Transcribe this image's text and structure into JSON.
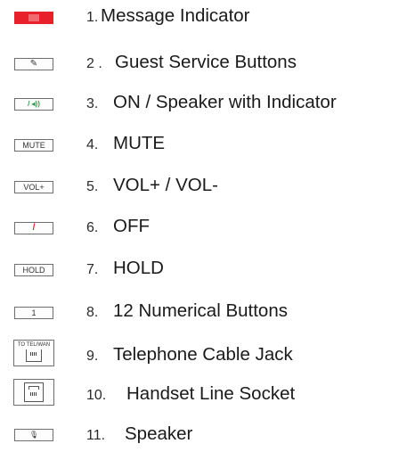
{
  "legend": [
    {
      "number": "1.",
      "label": "Message Indicator",
      "icon": "red-indicator-icon",
      "icon_text": ""
    },
    {
      "number": "2 .",
      "label": "Guest Service Buttons",
      "icon": "guest-service-icon",
      "icon_text": "✎"
    },
    {
      "number": "3.",
      "label": "ON / Speaker with Indicator",
      "icon": "handset-speaker-icon",
      "icon_text": "/ ◂))"
    },
    {
      "number": "4.",
      "label": "MUTE",
      "icon": "mute-key-icon",
      "icon_text": "MUTE"
    },
    {
      "number": "5.",
      "label": "VOL+ / VOL-",
      "icon": "vol-key-icon",
      "icon_text": "VOL+"
    },
    {
      "number": "6.",
      "label": "OFF",
      "icon": "off-handset-icon",
      "icon_text": "/"
    },
    {
      "number": "7.",
      "label": "HOLD",
      "icon": "hold-key-icon",
      "icon_text": "HOLD"
    },
    {
      "number": "8.",
      "label": "12 Numerical Buttons",
      "icon": "number-key-icon",
      "icon_text": "1"
    },
    {
      "number": "9.",
      "label": "Telephone Cable Jack",
      "icon": "telephone-jack-icon",
      "icon_text": "TO TEL/WAN"
    },
    {
      "number": "10.",
      "label": "Handset Line Socket",
      "icon": "handset-socket-icon",
      "icon_text": ""
    },
    {
      "number": "11.",
      "label": "Speaker",
      "icon": "speaker-icon",
      "icon_text": "🎙"
    }
  ],
  "colors": {
    "indicator_red": "#e8202c",
    "indicator_inner": "#f06a6f",
    "handset_green": "#2e9e4a",
    "handset_red": "#e8202c"
  }
}
